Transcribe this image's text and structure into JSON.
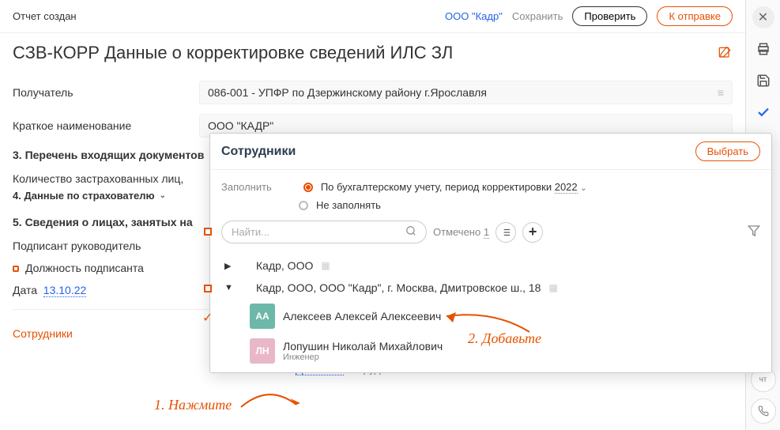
{
  "header": {
    "status": "Отчет создан",
    "org": "ООО \"Кадр\"",
    "save": "Сохранить",
    "check": "Проверить",
    "send": "К отправке"
  },
  "title": "СЗВ-КОРР Данные о корректировке сведений ИЛС ЗЛ",
  "form": {
    "recipient_label": "Получатель",
    "recipient_value": "086-001 - УПФР по Дзержинскому району г.Ярославля",
    "short_name_label": "Краткое наименование",
    "short_name_value": "ООО \"КАДР\"",
    "section_3": "3. Перечень входящих документов",
    "insured_count_label": "Количество застрахованных лиц,",
    "section_4": "4. Данные по страхователю",
    "section_5": "5. Сведения о лицах, занятых на",
    "signer_label": "Подписант руководитель",
    "position_label": "Должность подписанта",
    "date_label": "Дата",
    "date_value": "13.10.22",
    "employees_section": "Сотрудники"
  },
  "add_row": {
    "add_link": "Добавьте",
    "suffix": " сотрудников в отчет"
  },
  "popup": {
    "title": "Сотрудники",
    "select_btn": "Выбрать",
    "fill_label": "Заполнить",
    "radio_accounting": "По бухгалтерскому учету, период корректировки",
    "year": "2022",
    "radio_none": "Не заполнять",
    "search_placeholder": "Найти...",
    "marked_label": "Отмечено",
    "marked_count": "1",
    "org_1": "Кадр, ООО",
    "org_2": "Кадр, ООО, ООО \"Кадр\", г. Москва, Дмитровское ш., 18",
    "person_1_initials": "АА",
    "person_1_name": "Алексеев Алексей Алексеевич",
    "person_2_initials": "ЛН",
    "person_2_name": "Лопушин Николай Михайлович",
    "person_2_role": "Инженер"
  },
  "annotations": {
    "a1": "1. Нажмите",
    "a2": "2. Добавьте"
  },
  "sidebar_bottom": {
    "chat": "чт"
  }
}
